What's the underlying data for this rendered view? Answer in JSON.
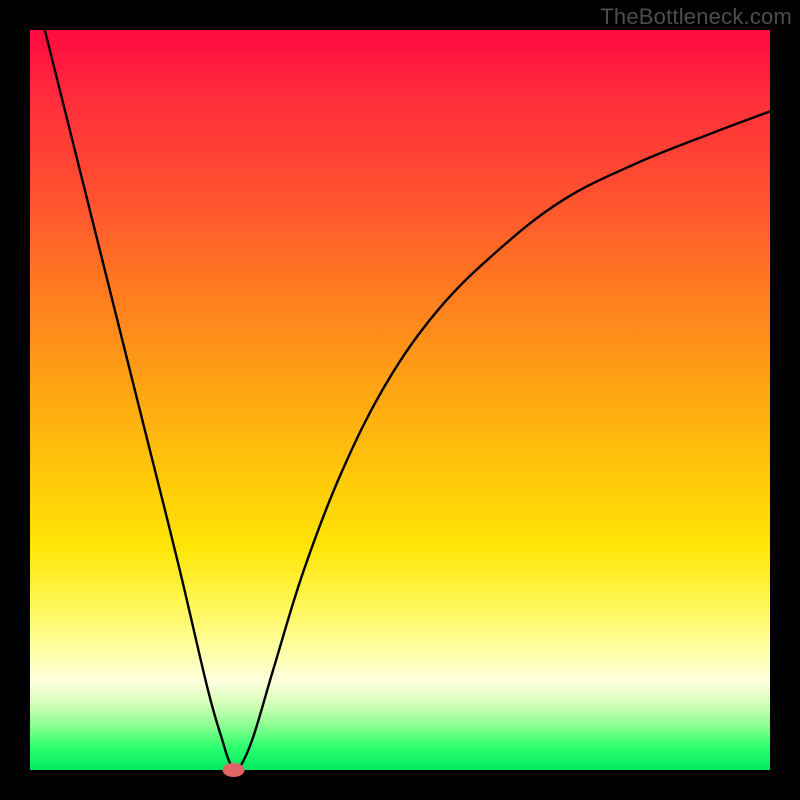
{
  "watermark": "TheBottleneck.com",
  "chart_data": {
    "type": "line",
    "title": "",
    "xlabel": "",
    "ylabel": "",
    "xlim": [
      0,
      100
    ],
    "ylim": [
      0,
      100
    ],
    "grid": false,
    "legend": false,
    "series": [
      {
        "name": "bottleneck-curve",
        "x": [
          2,
          5,
          10,
          15,
          20,
          24,
          26,
          27,
          28,
          30,
          33,
          37,
          42,
          48,
          55,
          63,
          72,
          82,
          92,
          100
        ],
        "y": [
          100,
          88,
          68,
          48,
          28,
          11,
          4,
          1,
          0,
          4,
          14,
          27,
          40,
          52,
          62,
          70,
          77,
          82,
          86,
          89
        ]
      }
    ],
    "marker": {
      "x": 27.5,
      "y": 0,
      "color": "#e06666"
    },
    "background_gradient": [
      "#ff0a40",
      "#ffa313",
      "#fff85a",
      "#00ea60"
    ]
  }
}
